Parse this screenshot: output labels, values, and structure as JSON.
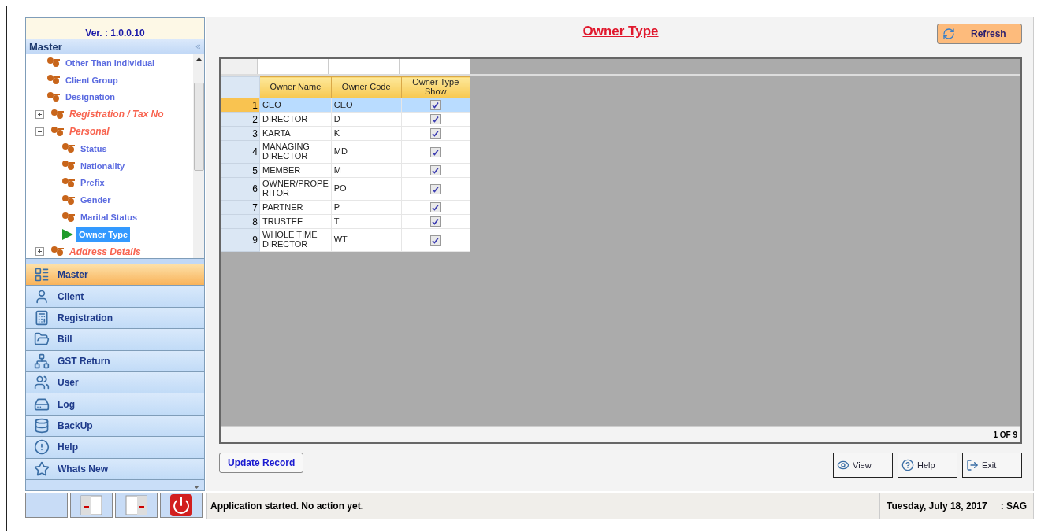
{
  "sidebar": {
    "version": "Ver. : 1.0.0.10",
    "panel_title": "Master",
    "collapse_glyph": "«",
    "tree": [
      {
        "label": "Other Than Individual",
        "kind": "leaf",
        "selected": false
      },
      {
        "label": "Client Group",
        "kind": "leaf",
        "selected": false
      },
      {
        "label": "Designation",
        "kind": "leaf",
        "selected": false
      },
      {
        "label": "Registration / Tax No",
        "kind": "group",
        "expanded": false,
        "selected": false
      },
      {
        "label": "Personal",
        "kind": "group",
        "expanded": true,
        "selected": false,
        "children": [
          {
            "label": "Status",
            "kind": "leaf",
            "selected": false
          },
          {
            "label": "Nationality",
            "kind": "leaf",
            "selected": false
          },
          {
            "label": "Prefix",
            "kind": "leaf",
            "selected": false
          },
          {
            "label": "Gender",
            "kind": "leaf",
            "selected": false
          },
          {
            "label": "Marital Status",
            "kind": "leaf",
            "selected": false
          },
          {
            "label": "Owner Type",
            "kind": "leaf",
            "selected": true
          }
        ]
      },
      {
        "label": "Address Details",
        "kind": "group",
        "expanded": false,
        "selected": false
      }
    ],
    "nav": [
      {
        "label": "Master",
        "selected": true
      },
      {
        "label": "Client",
        "selected": false
      },
      {
        "label": "Registration",
        "selected": false
      },
      {
        "label": "Bill",
        "selected": false
      },
      {
        "label": "GST Return",
        "selected": false
      },
      {
        "label": "User",
        "selected": false
      },
      {
        "label": "Log",
        "selected": false
      },
      {
        "label": "BackUp",
        "selected": false
      },
      {
        "label": "Help",
        "selected": false
      },
      {
        "label": "Whats New",
        "selected": false
      }
    ]
  },
  "main": {
    "title": "Owner Type",
    "refresh": "Refresh",
    "table": {
      "columns": [
        "Owner Name",
        "Owner Code",
        "Owner Type Show"
      ],
      "rows": [
        {
          "num": "1",
          "name": "CEO",
          "code": "CEO",
          "show": true,
          "selected": true
        },
        {
          "num": "2",
          "name": "DIRECTOR",
          "code": "D",
          "show": true,
          "selected": false
        },
        {
          "num": "3",
          "name": "KARTA",
          "code": "K",
          "show": true,
          "selected": false
        },
        {
          "num": "4",
          "name": "MANAGING DIRECTOR",
          "code": "MD",
          "show": true,
          "selected": false
        },
        {
          "num": "5",
          "name": "MEMBER",
          "code": "M",
          "show": true,
          "selected": false
        },
        {
          "num": "6",
          "name": "OWNER/PROPE RITOR",
          "code": "PO",
          "show": true,
          "selected": false
        },
        {
          "num": "7",
          "name": "PARTNER",
          "code": "P",
          "show": true,
          "selected": false
        },
        {
          "num": "8",
          "name": "TRUSTEE",
          "code": "T",
          "show": true,
          "selected": false
        },
        {
          "num": "9",
          "name": "WHOLE TIME DIRECTOR",
          "code": "WT",
          "show": true,
          "selected": false
        }
      ]
    },
    "record_count": "1 OF 9",
    "update_button": "Update Record",
    "buttons": [
      "View",
      "Help",
      "Exit"
    ]
  },
  "status_bar": {
    "message": "Application started. No action yet.",
    "date": "Tuesday, July 18, 2017",
    "user": ": SAG"
  }
}
